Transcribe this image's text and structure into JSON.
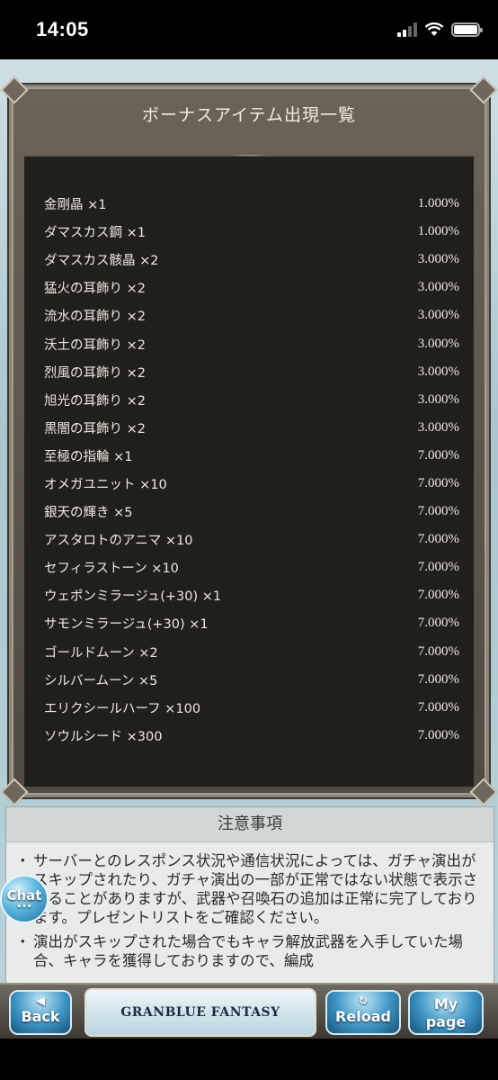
{
  "status_bar": {
    "time": "14:05"
  },
  "panel": {
    "title": "ボーナスアイテム出現一覧",
    "items": [
      {
        "name": "金剛晶 ×1",
        "rate": "1.000%"
      },
      {
        "name": "ダマスカス鋼 ×1",
        "rate": "1.000%"
      },
      {
        "name": "ダマスカス骸晶 ×2",
        "rate": "3.000%"
      },
      {
        "name": "猛火の耳飾り ×2",
        "rate": "3.000%"
      },
      {
        "name": "流水の耳飾り ×2",
        "rate": "3.000%"
      },
      {
        "name": "沃土の耳飾り ×2",
        "rate": "3.000%"
      },
      {
        "name": "烈風の耳飾り ×2",
        "rate": "3.000%"
      },
      {
        "name": "旭光の耳飾り ×2",
        "rate": "3.000%"
      },
      {
        "name": "黒闇の耳飾り ×2",
        "rate": "3.000%"
      },
      {
        "name": "至極の指輪 ×1",
        "rate": "7.000%"
      },
      {
        "name": "オメガユニット ×10",
        "rate": "7.000%"
      },
      {
        "name": "銀天の輝き ×5",
        "rate": "7.000%"
      },
      {
        "name": "アスタロトのアニマ ×10",
        "rate": "7.000%"
      },
      {
        "name": "セフィラストーン ×10",
        "rate": "7.000%"
      },
      {
        "name": "ウェポンミラージュ(+30) ×1",
        "rate": "7.000%"
      },
      {
        "name": "サモンミラージュ(+30) ×1",
        "rate": "7.000%"
      },
      {
        "name": "ゴールドムーン ×2",
        "rate": "7.000%"
      },
      {
        "name": "シルバームーン ×5",
        "rate": "7.000%"
      },
      {
        "name": "エリクシールハーフ ×100",
        "rate": "7.000%"
      },
      {
        "name": "ソウルシード ×300",
        "rate": "7.000%"
      }
    ]
  },
  "notes": {
    "title": "注意事項",
    "items": [
      "サーバーとのレスポンス状況や通信状況によっては、ガチャ演出がスキップされたり、ガチャ演出の一部が正常ではない状態で表示されることがありますが、武器や召喚石の追加は正常に完了しております。プレゼントリストをご確認ください。",
      "演出がスキップされた場合でもキャラ解放武器を入手していた場合、キャラを獲得しておりますので、編成"
    ]
  },
  "chat": {
    "label": "Chat",
    "dots": "•••"
  },
  "nav": {
    "back": "Back",
    "logo": "GRANBLUE FANTASY",
    "reload": "Reload",
    "mypage_line1": "My",
    "mypage_line2": "page"
  },
  "icons": {
    "back": "back-arrow-icon",
    "reload": "reload-icon",
    "signal": "cellular-signal-icon",
    "wifi": "wifi-icon",
    "battery": "battery-icon"
  },
  "colors": {
    "panel_bg": "#211f1c",
    "frame": "#6a6358",
    "text": "#ece8dd",
    "nav_button": "#3f95c4"
  }
}
